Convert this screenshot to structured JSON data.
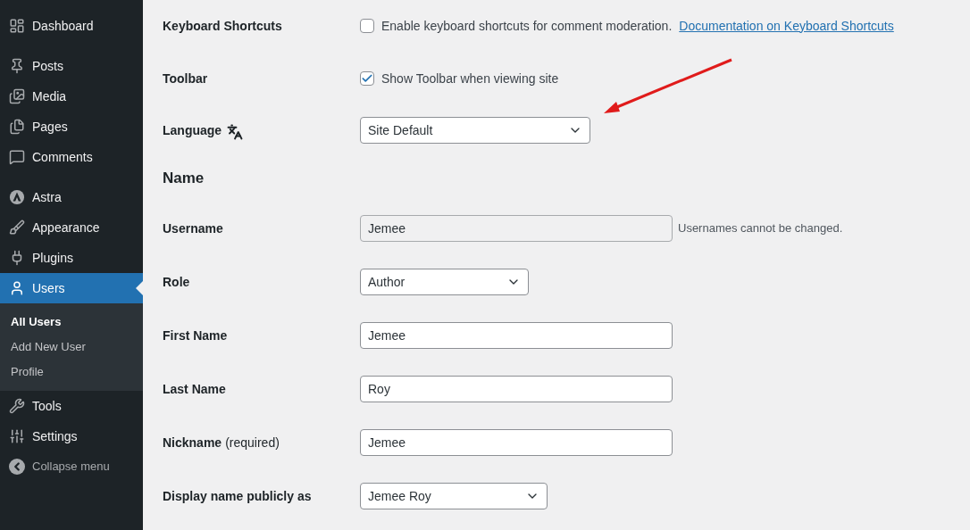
{
  "sidebar": {
    "items": [
      {
        "label": "Dashboard",
        "selected": false
      },
      {
        "label": "Posts",
        "selected": false
      },
      {
        "label": "Media",
        "selected": false
      },
      {
        "label": "Pages",
        "selected": false
      },
      {
        "label": "Comments",
        "selected": false
      },
      {
        "label": "Astra",
        "selected": false
      },
      {
        "label": "Appearance",
        "selected": false
      },
      {
        "label": "Plugins",
        "selected": false
      },
      {
        "label": "Users",
        "selected": true,
        "children": [
          {
            "label": "All Users",
            "selected": true
          },
          {
            "label": "Add New User",
            "selected": false
          },
          {
            "label": "Profile",
            "selected": false
          }
        ]
      },
      {
        "label": "Tools",
        "selected": false
      },
      {
        "label": "Settings",
        "selected": false
      }
    ],
    "collapse": "Collapse menu"
  },
  "form": {
    "rows": [
      {
        "kind": "checkbox",
        "label": "Keyboard Shortcuts",
        "checked": false,
        "text": "Enable keyboard shortcuts for comment moderation.",
        "link": "Documentation on Keyboard Shortcuts"
      },
      {
        "kind": "checkbox",
        "label": "Toolbar",
        "checked": true,
        "text": "Show Toolbar when viewing site"
      },
      {
        "kind": "select",
        "label": "Language",
        "value": "Site Default",
        "translate_icon": true
      },
      {
        "kind": "heading",
        "label": "Name"
      },
      {
        "kind": "text",
        "label": "Username",
        "value": "Jemee",
        "disabled": true,
        "hint": "Usernames cannot be changed."
      },
      {
        "kind": "select",
        "label": "Role",
        "value": "Author"
      },
      {
        "kind": "text",
        "label": "First Name",
        "value": "Jemee",
        "disabled": false
      },
      {
        "kind": "text",
        "label": "Last Name",
        "value": "Roy",
        "disabled": false
      },
      {
        "kind": "text",
        "label": "Nickname",
        "note": "(required)",
        "value": "Jemee",
        "disabled": false
      },
      {
        "kind": "select",
        "label": "Display name publicly as",
        "value": "Jemee Roy"
      }
    ]
  }
}
